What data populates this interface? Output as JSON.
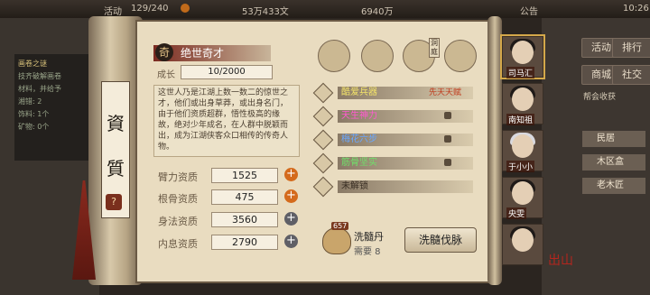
{
  "topbar": {
    "left_partial": "活动",
    "stamina": "129/240",
    "silver": "53万433文",
    "gold": "6940万",
    "notice": "公告",
    "time": "10:26"
  },
  "left_panel": {
    "title": "画卷之谜",
    "lines": [
      "技齐破解画卷",
      "材料，并给予",
      "湘错: 2",
      "饰料: 1个",
      "矿物: 0个"
    ]
  },
  "scroll": {
    "title_chars": [
      "資",
      "質"
    ],
    "help_icon": "?"
  },
  "character": {
    "talent_grade_mark": "奇",
    "talent_name": "绝世奇才",
    "growth_label": "成长",
    "growth_value": "10/2000",
    "description": "这世人乃是江湖上数一数二的惊世之才，他们或出身草莽，或出身名门，由于他们资质超群，悟性极高的缘故，绝对少年成名，在人群中脱颖而出，成为江湖侠客众口相传的传奇人物。"
  },
  "attributes": [
    {
      "label": "臂力资质",
      "value": "1525",
      "button": "+",
      "style": "orange"
    },
    {
      "label": "根骨资质",
      "value": "475",
      "button": "+",
      "style": "orange"
    },
    {
      "label": "身法资质",
      "value": "3560",
      "button": "+",
      "style": "grey"
    },
    {
      "label": "内息资质",
      "value": "2790",
      "button": "+",
      "style": "grey"
    }
  ],
  "talents": [
    {
      "label": "酷爱兵器",
      "tag": "先天天赋",
      "color": "#f3e36a",
      "locked": false
    },
    {
      "label": "天生神力",
      "tag": "",
      "color": "#ff5ad0",
      "locked": true
    },
    {
      "label": "梅花六步",
      "tag": "",
      "color": "#6aa8ff",
      "locked": true
    },
    {
      "label": "筋骨坚实",
      "tag": "",
      "color": "#6fe06a",
      "locked": true
    },
    {
      "label": "未解锁",
      "tag": "",
      "color": "#3a2f24",
      "locked": false
    }
  ],
  "top_icons": [
    "hat-icon",
    "scroll-icon",
    "yinyang-icon",
    "pouch-icon"
  ],
  "top_icon_badge": "洞庭",
  "pill": {
    "count": "657",
    "name": "洗髓丹",
    "need": "需要 8"
  },
  "wash_button": "洗髓伐脉",
  "portraits": [
    {
      "name": "司马汇"
    },
    {
      "name": "南知祖"
    },
    {
      "name": "于小小"
    },
    {
      "name": "央雯"
    },
    {
      "name": ""
    }
  ],
  "right_menu": {
    "buttons": [
      "活动",
      "排行",
      "商城",
      "社交"
    ],
    "section_title": "帮会收获",
    "list": [
      "民居",
      "木区盒",
      "老木匠"
    ]
  },
  "seal": "出山"
}
